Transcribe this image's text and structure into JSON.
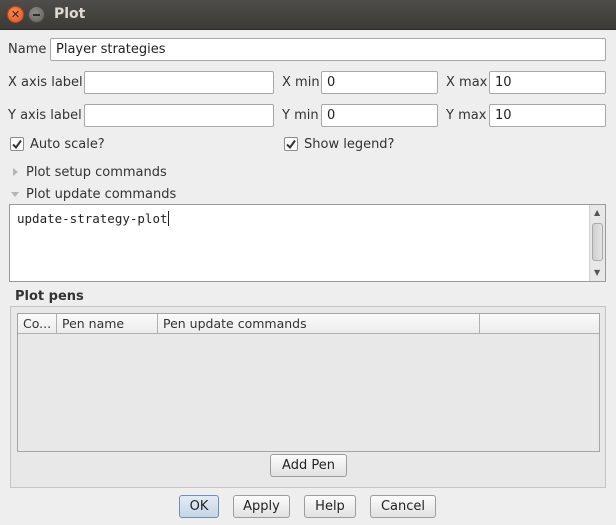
{
  "window": {
    "title": "Plot",
    "close_symbol": "✕",
    "minimize_symbol": ""
  },
  "form": {
    "name_label": "Name",
    "name_value": "Player strategies",
    "x_axis_label": "X axis label",
    "x_axis_value": "",
    "x_min_label": "X min",
    "x_min_value": "0",
    "x_max_label": "X max",
    "x_max_value": "10",
    "y_axis_label": "Y axis label",
    "y_axis_value": "",
    "y_min_label": "Y min",
    "y_min_value": "0",
    "y_max_label": "Y max",
    "y_max_value": "10",
    "auto_scale_label": "Auto scale?",
    "auto_scale_checked": true,
    "show_legend_label": "Show legend?",
    "show_legend_checked": true
  },
  "setup_commands": {
    "label": "Plot setup commands",
    "expanded": false
  },
  "update_commands": {
    "label": "Plot update commands",
    "expanded": true,
    "code": "update-strategy-plot"
  },
  "pens": {
    "title": "Plot pens",
    "columns": [
      "Co...",
      "Pen name",
      "Pen update commands",
      ""
    ],
    "rows": [],
    "add_pen_label": "Add Pen"
  },
  "footer": {
    "ok": "OK",
    "apply": "Apply",
    "help": "Help",
    "cancel": "Cancel"
  },
  "colors": {
    "titlebar": "#3c3b37",
    "close": "#e95420",
    "window_bg": "#eeeeee"
  },
  "icons": {
    "close": "close-icon",
    "minimize": "minimize-icon",
    "check": "check-icon",
    "expand": "expand-triangle-icon",
    "collapse": "collapse-triangle-icon"
  }
}
